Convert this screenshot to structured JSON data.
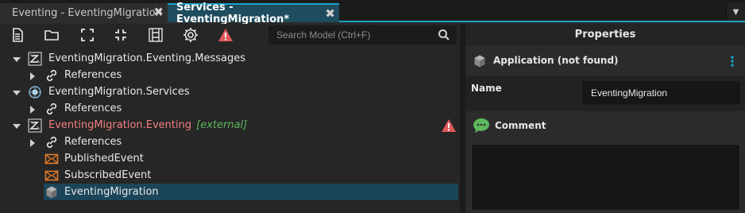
{
  "tabs": [
    {
      "label": "Eventing - EventingMigration",
      "active": false
    },
    {
      "label": "Services - EventingMigration*",
      "active": true
    }
  ],
  "tab_close_glyph": "✖",
  "toolbar": {
    "icons": [
      "new-file-icon",
      "open-folder-icon",
      "expand-all-icon",
      "collapse-all-icon",
      "diagram-icon",
      "settings-icon",
      "warning-icon"
    ],
    "search_placeholder": "Search Model (Ctrl+F)"
  },
  "tree": [
    {
      "label": "EventingMigration.Eventing.Messages",
      "level": 0,
      "expanded": true,
      "icon": "package-icon"
    },
    {
      "label": "References",
      "level": 1,
      "expanded": false,
      "icon": "link-icon"
    },
    {
      "label": "EventingMigration.Services",
      "level": 0,
      "expanded": true,
      "icon": "globe-icon"
    },
    {
      "label": "References",
      "level": 1,
      "expanded": false,
      "icon": "link-icon"
    },
    {
      "label": "EventingMigration.Eventing",
      "suffix": "[external]",
      "level": 0,
      "expanded": true,
      "icon": "package-icon",
      "warning": true
    },
    {
      "label": "References",
      "level": 1,
      "expanded": false,
      "icon": "link-icon"
    },
    {
      "label": "PublishedEvent",
      "level": 1,
      "icon": "envelope-icon"
    },
    {
      "label": "SubscribedEvent",
      "level": 1,
      "icon": "envelope-icon"
    },
    {
      "label": "EventingMigration",
      "level": 1,
      "icon": "cube-icon",
      "selected": true
    }
  ],
  "properties": {
    "title": "Properties",
    "application_label": "Application (not found)",
    "name_label": "Name",
    "name_value": "EventingMigration",
    "comment_label": "Comment",
    "comment_value": ""
  },
  "colors": {
    "accent": "#1da1c8",
    "selection": "#1b4559",
    "error_text": "#f07f7f",
    "external_text": "#5cb85c",
    "warning": "#e05a5a",
    "envelope": "#e07b2a"
  }
}
